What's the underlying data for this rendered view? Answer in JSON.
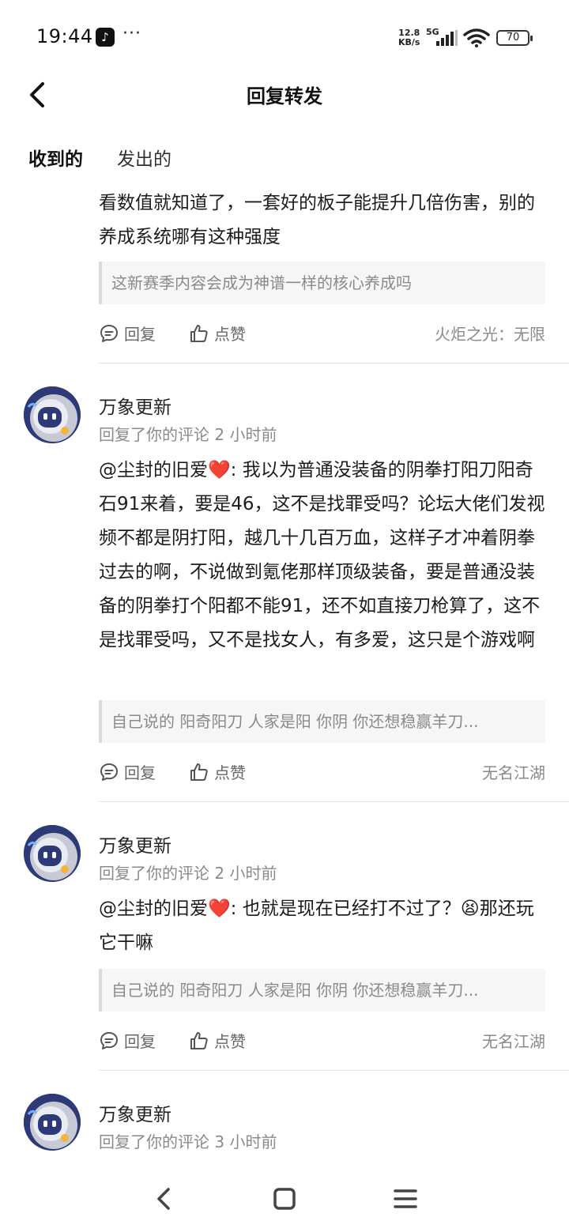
{
  "status_bar": {
    "time": "19:44",
    "net_speed_top": "12.8",
    "net_speed_bottom": "KB/s",
    "network": "5G",
    "battery": "70"
  },
  "header": {
    "title": "回复转发"
  },
  "tabs": [
    {
      "label": "收到的",
      "active": true
    },
    {
      "label": "发出的",
      "active": false
    }
  ],
  "actions": {
    "reply_label": "回复",
    "like_label": "点赞"
  },
  "items": [
    {
      "body": "看数值就知道了，一套好的板子能提升几倍伤害，别的养成系统哪有这种强度",
      "quote": "这新赛季内容会成为神谱一样的核心养成吗",
      "source": "火炬之光：无限"
    },
    {
      "name": "万象更新",
      "meta": "回复了你的评论 2 小时前",
      "mention": "@尘封的旧爱",
      "heart": "❤️",
      "body": ": 我以为普通没装备的阴拳打阳刀阳奇石91来着，要是46，这不是找罪受吗？论坛大佬们发视频不都是阴打阳，越几十几百万血，这样子才冲着阴拳过去的啊，不说做到氪佬那样顶级装备，要是普通没装备的阴拳打个阳都不能91，还不如直接刀枪算了，这不是找罪受吗，又不是找女人，有多爱，这只是个游戏啊",
      "quote": "自己说的 阳奇阳刀 人家是阳 你阴 你还想稳赢羊刀...",
      "source": "无名江湖"
    },
    {
      "name": "万象更新",
      "meta": "回复了你的评论 2 小时前",
      "mention": "@尘封的旧爱",
      "heart": "❤️",
      "body": ": 也就是现在已经打不过了？",
      "emoji": "😫",
      "body_tail": "那还玩它干嘛",
      "quote": "自己说的 阳奇阳刀 人家是阳 你阴 你还想稳赢羊刀...",
      "source": "无名江湖"
    },
    {
      "name": "万象更新",
      "meta": "回复了你的评论 3 小时前"
    }
  ]
}
